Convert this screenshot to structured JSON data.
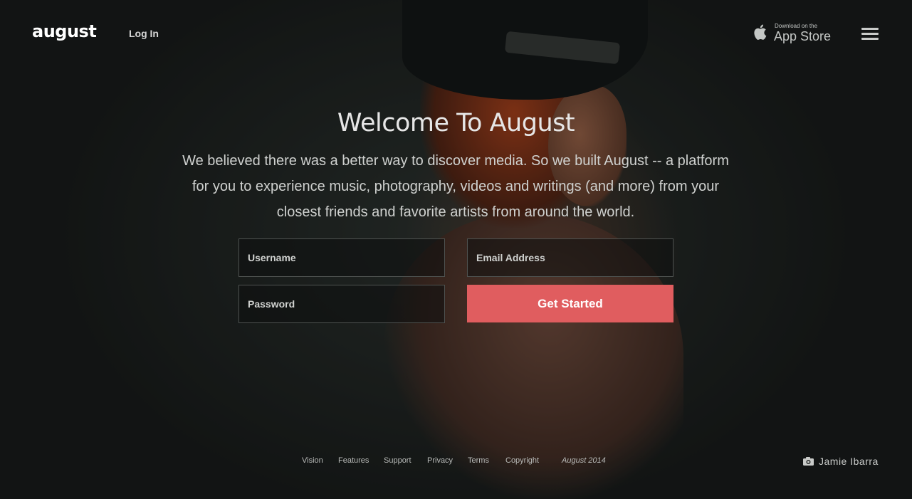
{
  "brand": {
    "logo_text": "august"
  },
  "header": {
    "login_label": "Log In",
    "appstore_small": "Download on the",
    "appstore_big": "App Store",
    "appstore_icon": "apple-icon",
    "menu_icon": "hamburger-menu-icon"
  },
  "hero": {
    "title": "Welcome To August",
    "description": "We believed there was a better way to discover media. So we built August -- a platform for you to experience music, photography, videos and writings (and more) from your closest friends and favorite artists from around the world."
  },
  "form": {
    "username_placeholder": "Username",
    "email_placeholder": "Email Address",
    "password_placeholder": "Password",
    "submit_label": "Get Started"
  },
  "footer": {
    "links": [
      "Vision",
      "Features",
      "Support",
      "Privacy",
      "Terms",
      "Copyright"
    ],
    "year_text": "August 2014"
  },
  "photo_credit": {
    "icon": "camera-icon",
    "name": "Jamie Ibarra"
  },
  "colors": {
    "accent": "#e05d5f",
    "background": "#1b1d1c"
  }
}
